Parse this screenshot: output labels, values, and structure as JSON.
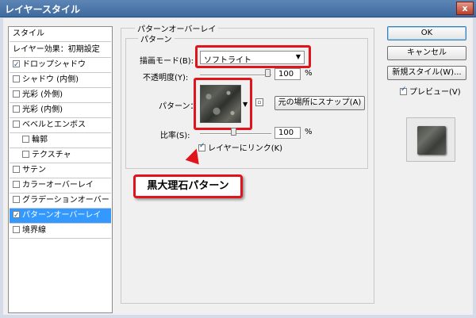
{
  "window": {
    "title": "レイヤースタイル",
    "close_label": "x"
  },
  "style_list": {
    "header": "スタイル",
    "items": [
      {
        "label": "レイヤー効果：初期設定",
        "checkbox": false,
        "checked": false,
        "indent": false,
        "selected": false
      },
      {
        "label": "ドロップシャドウ",
        "checkbox": true,
        "checked": true,
        "indent": false,
        "selected": false
      },
      {
        "label": "シャドウ (内側)",
        "checkbox": true,
        "checked": false,
        "indent": false,
        "selected": false
      },
      {
        "label": "光彩 (外側)",
        "checkbox": true,
        "checked": false,
        "indent": false,
        "selected": false
      },
      {
        "label": "光彩 (内側)",
        "checkbox": true,
        "checked": false,
        "indent": false,
        "selected": false
      },
      {
        "label": "ベベルとエンボス",
        "checkbox": true,
        "checked": false,
        "indent": false,
        "selected": false
      },
      {
        "label": "輪郭",
        "checkbox": true,
        "checked": false,
        "indent": true,
        "selected": false
      },
      {
        "label": "テクスチャ",
        "checkbox": true,
        "checked": false,
        "indent": true,
        "selected": false
      },
      {
        "label": "サテン",
        "checkbox": true,
        "checked": false,
        "indent": false,
        "selected": false
      },
      {
        "label": "カラーオーバーレイ",
        "checkbox": true,
        "checked": false,
        "indent": false,
        "selected": false
      },
      {
        "label": "グラデーションオーバーレイ",
        "checkbox": true,
        "checked": false,
        "indent": false,
        "selected": false
      },
      {
        "label": "パターンオーバーレイ",
        "checkbox": true,
        "checked": true,
        "indent": false,
        "selected": true
      },
      {
        "label": "境界線",
        "checkbox": true,
        "checked": false,
        "indent": false,
        "selected": false
      }
    ]
  },
  "panel": {
    "group_title": "パターンオーバーレイ",
    "subgroup_title": "パターン",
    "blend_mode_label": "描画モード(B):",
    "blend_mode_value": "ソフトライト",
    "opacity_label": "不透明度(Y):",
    "opacity_value": "100",
    "percent": "%",
    "pattern_label": "パターン：",
    "snap_button": "元の場所にスナップ(A)",
    "scale_label": "比率(S):",
    "scale_value": "100",
    "link_label": "レイヤーにリンク(K)",
    "link_checked": true
  },
  "buttons": {
    "ok": "OK",
    "cancel": "キャンセル",
    "new_style": "新規スタイル(W)...",
    "preview_label": "プレビュー(V)",
    "preview_checked": true
  },
  "annotation": {
    "callout_text": "黒大理石パターン"
  },
  "colors": {
    "highlight_red": "#e0141a",
    "selection_blue": "#3399ff"
  }
}
